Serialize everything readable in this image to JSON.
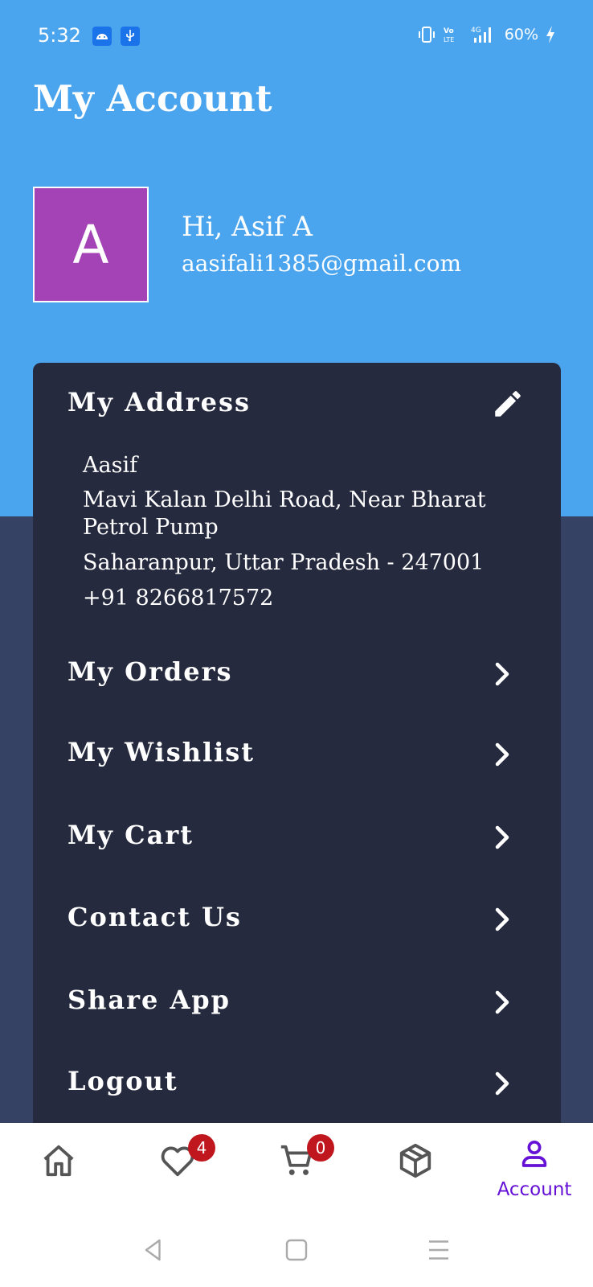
{
  "status_bar": {
    "time": "5:32",
    "battery": "60%",
    "network": "4G"
  },
  "header": {
    "title": "My Account"
  },
  "profile": {
    "avatar_letter": "A",
    "greeting": "Hi, Asif A",
    "email": "aasifali1385@gmail.com"
  },
  "address": {
    "title": "My Address",
    "name": "Aasif",
    "street": "Mavi Kalan Delhi Road, Near Bharat Petrol Pump",
    "city_state": "Saharanpur, Uttar Pradesh - 247001",
    "phone": "+91 8266817572"
  },
  "menu": {
    "items": [
      {
        "label": "My Orders"
      },
      {
        "label": "My Wishlist"
      },
      {
        "label": "My Cart"
      },
      {
        "label": "Contact Us"
      },
      {
        "label": "Share App"
      },
      {
        "label": "Logout"
      }
    ]
  },
  "bottom_nav": {
    "wishlist_count": "4",
    "cart_count": "0",
    "account_label": "Account"
  },
  "colors": {
    "header_blue": "#4ba5ee",
    "card_dark": "#262a3e",
    "lower_bg": "#364263",
    "avatar_purple": "#a443b6",
    "active_nav": "#6512d6",
    "badge_red": "#c0161e"
  }
}
